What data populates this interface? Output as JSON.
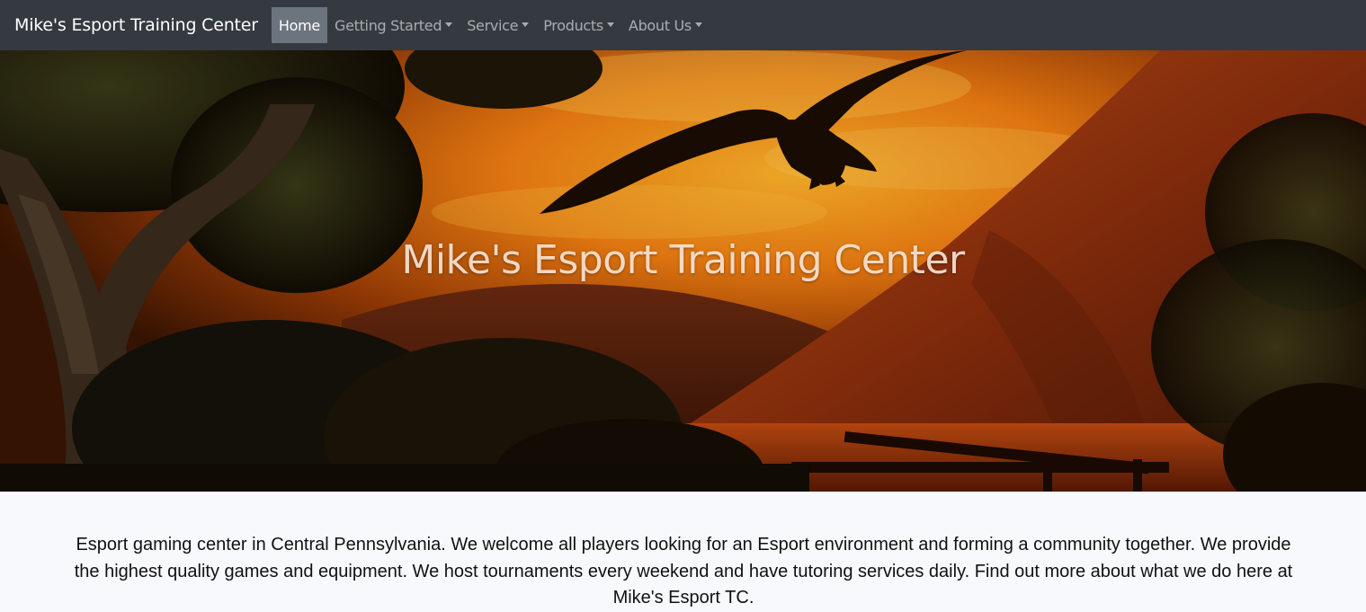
{
  "navbar": {
    "brand": "Mike's Esport Training Center",
    "items": [
      {
        "label": "Home",
        "active": true,
        "dropdown": false
      },
      {
        "label": "Getting Started",
        "active": false,
        "dropdown": true
      },
      {
        "label": "Service",
        "active": false,
        "dropdown": true
      },
      {
        "label": "Products",
        "active": false,
        "dropdown": true
      },
      {
        "label": "About Us",
        "active": false,
        "dropdown": true
      }
    ]
  },
  "hero": {
    "title": "Mike's Esport Training Center"
  },
  "main": {
    "description": "Esport gaming center in Central Pennsylvania. We welcome all players looking for an Esport environment and forming a community together. We provide the highest quality games and equipment. We host tournaments every weekend and have tutoring services daily. Find out more about what we do here at Mike's Esport TC."
  },
  "colors": {
    "navbar_bg": "#343a40",
    "active_bg": "#6c757d",
    "page_bg": "#f8f9fc"
  }
}
